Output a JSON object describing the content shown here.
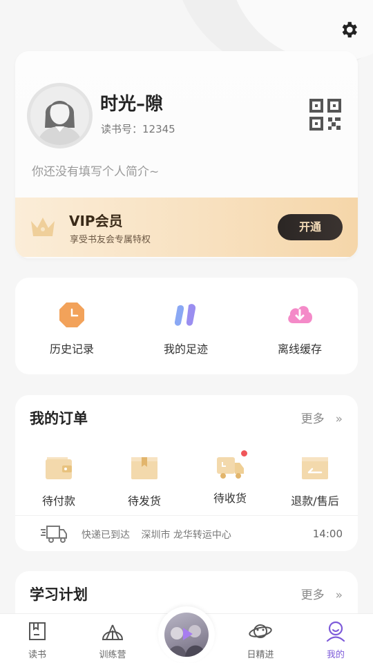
{
  "header": {
    "settings_icon": "gear-icon"
  },
  "profile": {
    "name": "时光–隙",
    "read_no": "读书号：12345",
    "bio": "你还没有填写个人简介~",
    "qr_icon": "qr-code-icon"
  },
  "vip": {
    "title": "VIP会员",
    "subtitle": "享受书友会专属特权",
    "button": "开通",
    "accent": "#f5d6a9"
  },
  "tools": [
    {
      "label": "历史记录",
      "icon": "history-clock-icon",
      "color": "#f2a25a"
    },
    {
      "label": "我的足迹",
      "icon": "footprint-icon",
      "color": "#7c8cf0"
    },
    {
      "label": "离线缓存",
      "icon": "cloud-download-icon",
      "color": "#f07bc4"
    }
  ],
  "orders": {
    "title": "我的订单",
    "more": "更多",
    "items": [
      {
        "label": "待付款",
        "icon": "wallet-icon"
      },
      {
        "label": "待发货",
        "icon": "package-icon"
      },
      {
        "label": "待收货",
        "icon": "truck-icon",
        "has_dot": true
      },
      {
        "label": "退款/售后",
        "icon": "refund-icon"
      }
    ],
    "delivery": {
      "status": "快递已到达",
      "location": "深圳市 龙华转运中心",
      "time": "14:00"
    }
  },
  "study": {
    "title": "学习计划",
    "more": "更多"
  },
  "tabbar": {
    "items": [
      {
        "label": "读书",
        "icon": "book-icon"
      },
      {
        "label": "训练营",
        "icon": "camp-tent-icon"
      },
      {
        "label": "日精进",
        "icon": "planet-icon"
      },
      {
        "label": "我的",
        "icon": "profile-icon",
        "active": true
      }
    ],
    "active_color": "#7d5ad9"
  }
}
